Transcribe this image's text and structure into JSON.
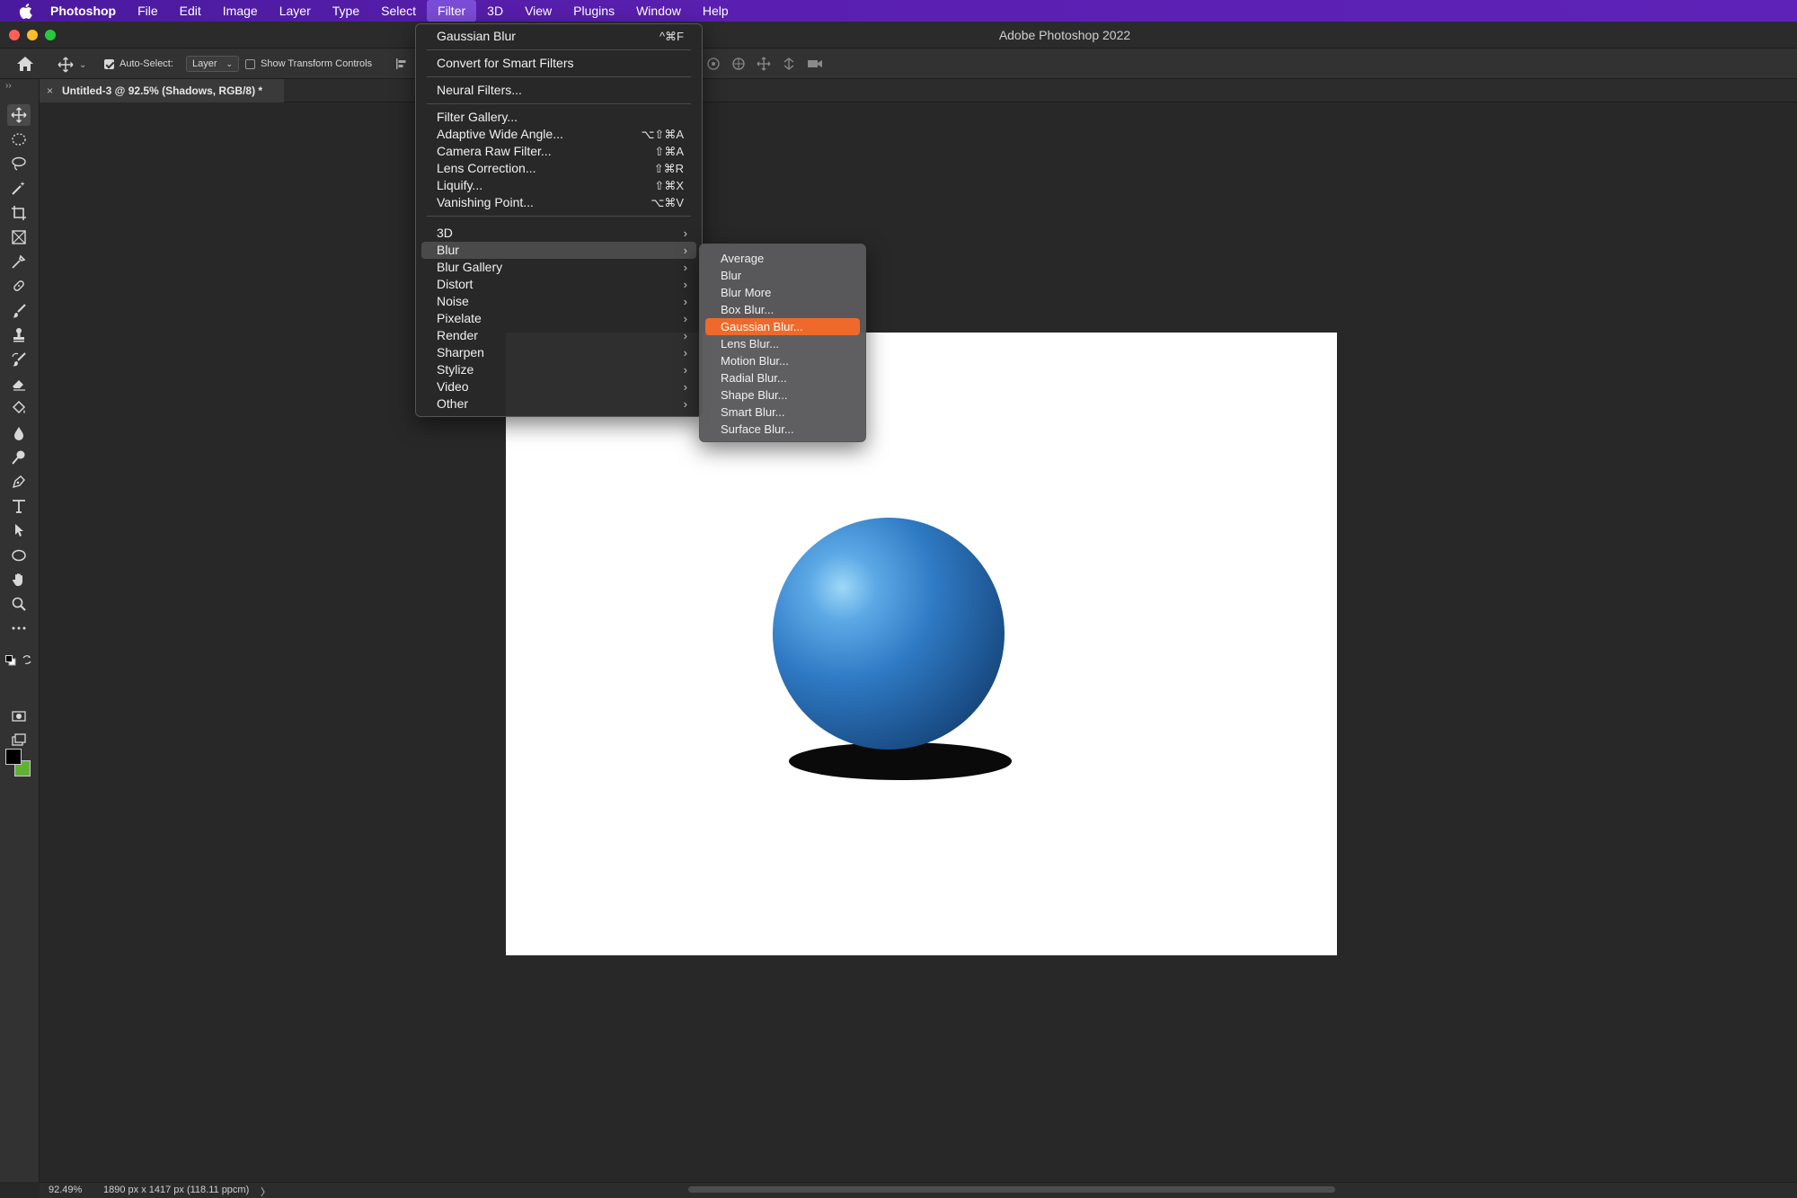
{
  "menubar": {
    "app": "Photoshop",
    "items": [
      "File",
      "Edit",
      "Image",
      "Layer",
      "Type",
      "Select",
      "Filter",
      "3D",
      "View",
      "Plugins",
      "Window",
      "Help"
    ],
    "active": "Filter"
  },
  "window": {
    "title": "Adobe Photoshop 2022"
  },
  "options_bar": {
    "auto_select_label": "Auto-Select:",
    "auto_select_checked": true,
    "auto_select_target": "Layer",
    "show_transform_label": "Show Transform Controls",
    "show_transform_checked": false
  },
  "document": {
    "tab_title": "Untitled-3 @ 92.5% (Shadows, RGB/8) *",
    "close_glyph": "×"
  },
  "status": {
    "zoom": "92.49%",
    "doc_info": "1890 px x 1417 px (118.11 ppcm)",
    "arrow": "〉"
  },
  "filter_menu": {
    "last_filter": {
      "label": "Gaussian Blur",
      "shortcut": "^⌘F"
    },
    "convert": "Convert for Smart Filters",
    "neural": "Neural Filters...",
    "gallery_group": [
      {
        "label": "Filter Gallery...",
        "shortcut": ""
      },
      {
        "label": "Adaptive Wide Angle...",
        "shortcut": "⌥⇧⌘A"
      },
      {
        "label": "Camera Raw Filter...",
        "shortcut": "⇧⌘A"
      },
      {
        "label": "Lens Correction...",
        "shortcut": "⇧⌘R"
      },
      {
        "label": "Liquify...",
        "shortcut": "⇧⌘X"
      },
      {
        "label": "Vanishing Point...",
        "shortcut": "⌥⌘V"
      }
    ],
    "submenus": [
      "3D",
      "Blur",
      "Blur Gallery",
      "Distort",
      "Noise",
      "Pixelate",
      "Render",
      "Sharpen",
      "Stylize",
      "Video",
      "Other"
    ],
    "highlighted": "Blur",
    "arrow": "›"
  },
  "blur_menu": {
    "items": [
      "Average",
      "Blur",
      "Blur More",
      "Box Blur...",
      "Gaussian Blur...",
      "Lens Blur...",
      "Motion Blur...",
      "Radial Blur...",
      "Shape Blur...",
      "Smart Blur...",
      "Surface Blur..."
    ],
    "highlighted": "Gaussian Blur..."
  },
  "colors": {
    "menubar": "#5a1fb0",
    "highlight_orange": "#ef6a2a",
    "foreground_swatch": "#000000",
    "background_swatch": "#5fb233",
    "sphere": "#2f7ac4"
  },
  "toolbar_icons": [
    "move-tool-icon",
    "marquee-tool-icon",
    "lasso-tool-icon",
    "magic-wand-icon",
    "crop-tool-icon",
    "frame-tool-icon",
    "eyedropper-icon",
    "healing-brush-icon",
    "brush-tool-icon",
    "clone-stamp-icon",
    "history-brush-icon",
    "eraser-icon",
    "paint-bucket-icon",
    "blur-tool-icon",
    "dodge-tool-icon",
    "pen-tool-icon",
    "type-tool-icon",
    "path-selection-icon",
    "ellipse-tool-icon",
    "hand-tool-icon",
    "zoom-tool-icon",
    "more-tools-icon"
  ]
}
